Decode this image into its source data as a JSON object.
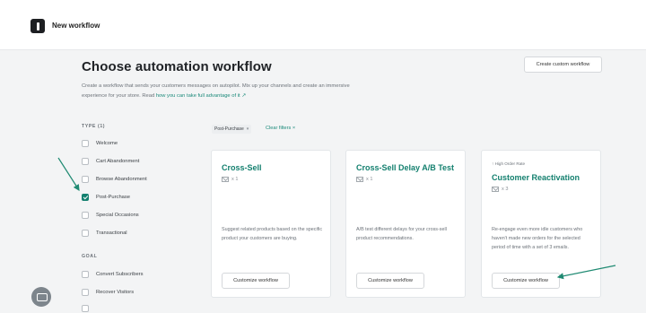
{
  "header": {
    "title": "New workflow"
  },
  "page": {
    "title": "Choose automation workflow",
    "custom_button": "Create custom workflow",
    "description": "Create a workflow that sends your customers messages on autopilot. Mix up your channels and create an immersive experience for your store. Read ",
    "description_link": "how you can take full advantage of it"
  },
  "filters": {
    "type_heading": "TYPE (1)",
    "type_items": [
      {
        "label": "Welcome",
        "checked": false
      },
      {
        "label": "Cart Abandonment",
        "checked": false
      },
      {
        "label": "Browse Abandonment",
        "checked": false
      },
      {
        "label": "Post-Purchase",
        "checked": true
      },
      {
        "label": "Special Occasions",
        "checked": false
      },
      {
        "label": "Transactional",
        "checked": false
      }
    ],
    "goal_heading": "GOAL",
    "goal_items": [
      {
        "label": "Convert Subscribers",
        "checked": false
      },
      {
        "label": "Recover Visitors",
        "checked": false
      }
    ]
  },
  "active_filters": {
    "chip": "Post-Purchase",
    "clear": "Clear filters"
  },
  "cards": [
    {
      "badge": "",
      "title": "Cross-Sell",
      "count": "x 1",
      "description": "Suggest related products based on the specific product your customers are buying.",
      "button": "Customize workflow"
    },
    {
      "badge": "",
      "title": "Cross-Sell Delay A/B Test",
      "count": "x 1",
      "description": "A/B test different delays for your cross-sell product recommendations.",
      "button": "Customize workflow"
    },
    {
      "badge": "High Order Rate",
      "title": "Customer Reactivation",
      "count": "x 3",
      "description": "Re-engage even more idle customers who haven't made new orders for the selected period of time with a set of 3 emails.",
      "button": "Customize workflow"
    }
  ],
  "colors": {
    "accent": "#14806f",
    "arrow": "#1f8a72"
  }
}
